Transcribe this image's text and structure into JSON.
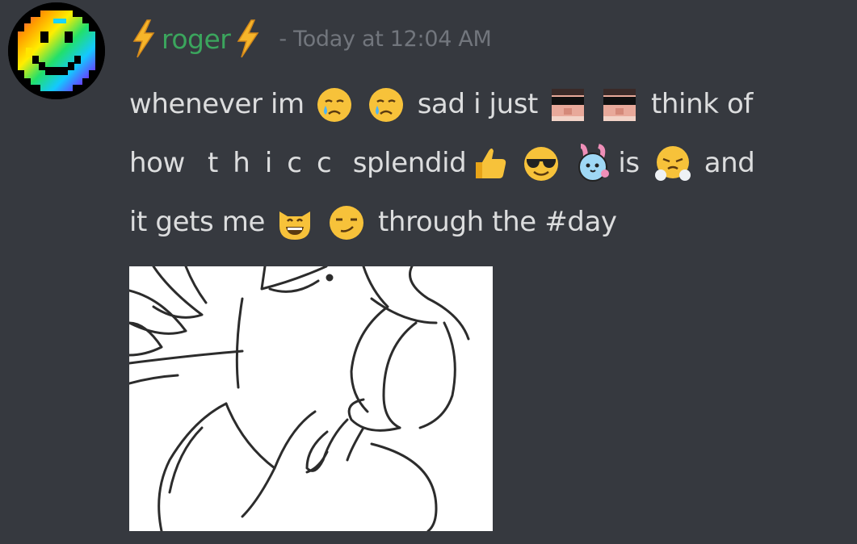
{
  "message": {
    "author": {
      "name": "roger",
      "name_color": "#3ba55d",
      "decoration_icon": "lightning-bolt-icon"
    },
    "timestamp": "- Today at 12:04 AM",
    "lines": [
      {
        "segments": [
          {
            "type": "text",
            "text": "whenever im"
          },
          {
            "type": "emoji",
            "name": "crying-face-emoji"
          },
          {
            "type": "emoji",
            "name": "crying-face-emoji"
          },
          {
            "type": "text",
            "text": "sad i just"
          },
          {
            "type": "emoji",
            "name": "sunglasses-face-custom-emoji"
          },
          {
            "type": "emoji",
            "name": "sunglasses-face-custom-emoji"
          },
          {
            "type": "text",
            "text": "think of"
          }
        ]
      },
      {
        "segments": [
          {
            "type": "text",
            "text": "how"
          },
          {
            "type": "text",
            "text": "thicc",
            "style": "spaced"
          },
          {
            "type": "text",
            "text": "splendid"
          },
          {
            "type": "emoji",
            "name": "thumbs-up-emoji"
          },
          {
            "type": "emoji",
            "name": "smiling-face-with-sunglasses-emoji"
          },
          {
            "type": "emoji",
            "name": "bunny-custom-emoji"
          },
          {
            "type": "text",
            "text": "is"
          },
          {
            "type": "emoji",
            "name": "face-with-steam-emoji"
          },
          {
            "type": "text",
            "text": "and"
          }
        ]
      },
      {
        "segments": [
          {
            "type": "text",
            "text": "it gets me"
          },
          {
            "type": "emoji",
            "name": "grinning-cat-emoji"
          },
          {
            "type": "emoji",
            "name": "smirking-face-emoji"
          },
          {
            "type": "text",
            "text": "through the #day"
          }
        ]
      }
    ],
    "attachment": {
      "type": "image",
      "description_icon": "sketch-image"
    }
  },
  "colors": {
    "background": "#36393f",
    "text": "#dcddde",
    "timestamp": "#72767d",
    "username": "#3ba55d"
  }
}
